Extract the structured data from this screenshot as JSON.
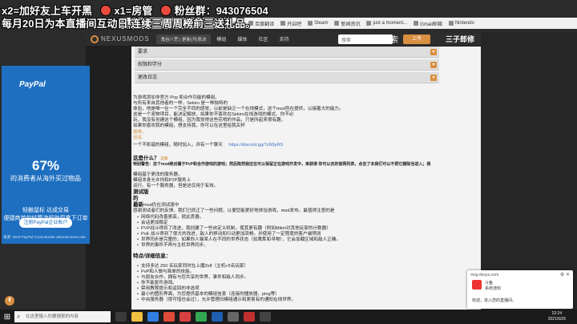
{
  "overlay": {
    "line1_a": "x2=加好友上车开黑",
    "line1_b": "x1=房管",
    "line1_c": "粉丝群：943076504",
    "line2": "每月20日为本直播间互动日,连续三周周榜前三送礼品。"
  },
  "bookmarks": [
    "应用",
    "游戏",
    "Bili",
    "Bili搜索",
    "新闻通知",
    "百度翻译",
    "开启吧",
    "Steam",
    "新闻资讯",
    "just a moment...",
    "Gmail邮箱",
    "Nintendo"
  ],
  "nexus": {
    "logo": "NEXUSMODS",
    "game_select": "鬼谷八荒 | 更新|开|表决",
    "nav": [
      "模组",
      "媒体",
      "社区",
      "支持"
    ],
    "search_placeholder": "搜索",
    "search_label": "搜索",
    "upload": "上传",
    "watermark": "三子郎修"
  },
  "accordion": [
    "要求",
    "权限和学分",
    "更改日志"
  ],
  "content": {
    "intro": [
      "为游戏添加非官方 Pvp 和合作功能的模组。",
      "与所有来自其他者的一样，Sekiro 是一种独特的",
      "体验，他是唯一在一个完全不同的感觉，以前是缺乏一个在线模式，这个mod旨在提供，以接着大的能力。",
      "这是一个宠物项目，能决定解放，如果你不喜欢在Sekiro在线游戏的模式，你不必",
      "玩，我没有创建这个模组，因为我觉得这些花哨的作品，只是所起来很有趣。",
      "如果你喜欢我的模组，想支持我，你可以在这里给我买杯"
    ],
    "link1": "咖啡。",
    "link2": "也有",
    "discord_text": "一个不和谐的模组，随时加入，并有一个聊天",
    "discord_url": "https://discord.gg/7zN9yRS",
    "what_is": "这是什么？",
    "what_is_tag": "正如",
    "warning": "特别警告：这个mod绝对属于PvP和合作游戏的游戏；然后既然我还在可以保留正在游戏开发中，来获得 你可以去的官网列表，点击了本我们可以不把它删除当进入；我",
    "build_a": "模组基于更改的服务器，",
    "build_b": "模组本身允许你和P2P服务上",
    "build_c": "运行。有一个服务器，但是这仅用于有效。",
    "test_title": "测试版",
    "of": "的",
    "latest": "最新",
    "latest_rest": "mod仍在测试版中",
    "test_desc": "感谢测试者们的反馈，我们已修正了一些问题，以便您能更好地体验游戏，mod发布。最值得注意的是",
    "fixes": [
      "网络代码改善更高，就此丢器。",
      "会话更加稳定",
      "PVP战斗得到了改进，我创建了一些自定义机制，使其更有趣（例如Mikiri对其他玩家的计数器）",
      "PvE 战斗得到了很大的改进，敌人的移动和行动更加流畅，并使用了一定程度的客户端预测",
      "世界同步是完整的，如果你人猫某人在不同的世界状态（如鹰隼和寻物），它会加载区域和敌人正确。",
      "世界的事件不再与主机世界同步。"
    ],
    "features_title": "特点/详细信息：",
    "features": [
      "支持多达 250 名玩家同时在上魔2v8（主机+5名玩家）",
      "PvP和人做与简单的技能。",
      "与朋友合作，拥有与您共享的世界，事件和敌人同步。",
      "你不能复件游戏。",
      "禁用教程提示和返回的非选项",
      "最小的图形界面，为您提供基本的模组信息（连接的播放器，ping等）",
      "中央服务器（很可惜也会过），允许管理旧模组通示和更易有的通知在线世界。"
    ]
  },
  "ad": {
    "brand": "PayPal",
    "percent": "67%",
    "line1": "的消费者从海外买过物品",
    "line2": "轻触鼠标 达成交易",
    "line3": "便捷商单的结算流程助您拿下订单",
    "button": "注册PayPal企业账户",
    "footer": "来源: 2019 PayPal Cross-Border abandonment rate"
  },
  "notification": {
    "app": "msg.douyu.com",
    "controls": "⚙ ✕",
    "title": "斗鱼",
    "body": "系统通知",
    "message": "欢迎，进入您的直播间。"
  },
  "taskbar": {
    "search_placeholder": "在这里输入你要搜索的内容",
    "time": "22:24",
    "date": "2021/6/26"
  }
}
